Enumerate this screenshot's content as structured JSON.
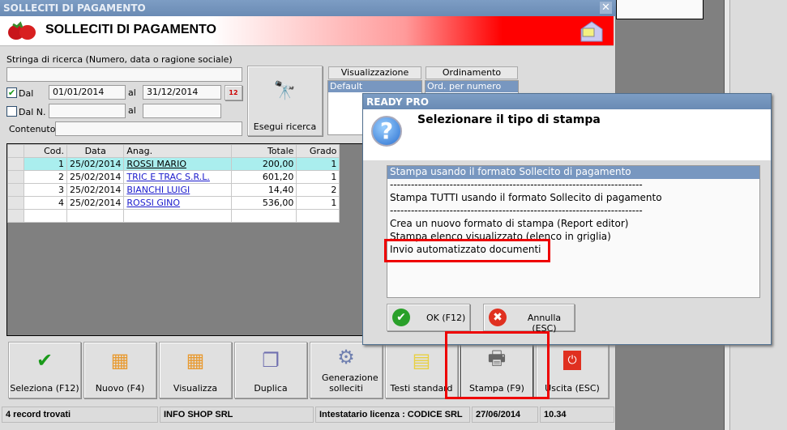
{
  "window": {
    "title": "SOLLECITI DI PAGAMENTO",
    "header_title": "SOLLECITI DI PAGAMENTO",
    "close": "✕"
  },
  "search": {
    "label": "Stringa di ricerca (Numero, data o ragione sociale)",
    "value": "",
    "dal_label": "Dal",
    "dal_checked": true,
    "date_from": "01/01/2014",
    "al_label": "al",
    "date_to": "31/12/2014",
    "daln_label": "Dal N.",
    "daln_checked": false,
    "num_from": "",
    "num_to": "",
    "contenuto_label": "Contenuto",
    "contenuto": "",
    "search_button": "Esegui ricerca",
    "calendar_text": "12"
  },
  "visualizzazione": {
    "header": "Visualizzazione",
    "selected": "Default"
  },
  "ordinamento": {
    "header": "Ordinamento",
    "selected": "Ord. per numero"
  },
  "grid": {
    "columns": [
      "Cod.",
      "Data",
      "Anag.",
      "Totale",
      "Grado"
    ],
    "rows": [
      {
        "cod": "1",
        "data": "25/02/2014",
        "anag": "ROSSI MARIO",
        "totale": "200,00",
        "grado": "1"
      },
      {
        "cod": "2",
        "data": "25/02/2014",
        "anag": "TRIC E TRAC S.R.L.",
        "totale": "601,20",
        "grado": "1"
      },
      {
        "cod": "3",
        "data": "25/02/2014",
        "anag": "BIANCHI LUIGI",
        "totale": "14,40",
        "grado": "2"
      },
      {
        "cod": "4",
        "data": "25/02/2014",
        "anag": "ROSSI GINO",
        "totale": "536,00",
        "grado": "1"
      }
    ]
  },
  "toolbar": [
    "Seleziona (F12)",
    "Nuovo (F4)",
    "Visualizza",
    "Duplica",
    "Generazione solleciti",
    "Testi standard",
    "Stampa (F9)",
    "Uscita (ESC)"
  ],
  "status": {
    "records": "4 record trovati",
    "company": "INFO SHOP SRL",
    "license": "Intestatario licenza : CODICE SRL",
    "date": "27/06/2014",
    "time": "10.34"
  },
  "dialog": {
    "title": "READY PRO",
    "question": "Selezionare il tipo di stampa",
    "question_mark": "?",
    "options": [
      "Stampa usando il formato Sollecito di pagamento",
      "------------------------------------------------------------------------",
      "Stampa TUTTI usando il formato Sollecito di pagamento",
      "------------------------------------------------------------------------",
      "Crea un nuovo formato di stampa (Report editor)",
      "Stampa elenco visualizzato (elenco in griglia)",
      "Invio automatizzato documenti"
    ],
    "ok": "OK (F12)",
    "cancel": "Annulla (ESC)"
  },
  "colors": {
    "titlebar": "#6a8bb4",
    "selection": "#7897c0",
    "row_highlight": "#aaeeee",
    "highlight_box": "#e00000"
  }
}
